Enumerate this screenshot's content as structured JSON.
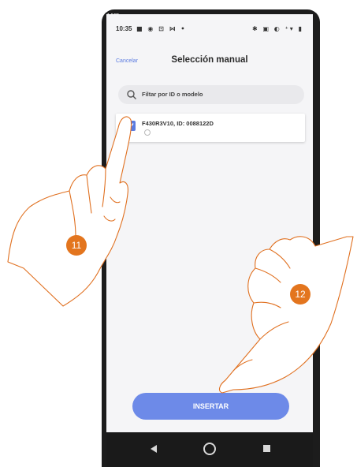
{
  "status_bar": {
    "time": "10:35",
    "left_icons": "■ ◉ ⊡ ⋈ •",
    "right_icons": "✱ ▣ ◐ ⁺▾ ▮"
  },
  "header": {
    "cancel_label": "Cancelar",
    "title": "Selección manual"
  },
  "search": {
    "placeholder": "Filtar por ID o modelo"
  },
  "device": {
    "label": "F430R3V10, ID: 0088122D",
    "checked": true
  },
  "insert_button": {
    "label": "INSERTAR"
  },
  "annotations": {
    "step_a": "11",
    "step_b": "12"
  },
  "colors": {
    "accent": "#5b7be0",
    "button": "#6d8ae8",
    "badge": "#e3751e"
  }
}
